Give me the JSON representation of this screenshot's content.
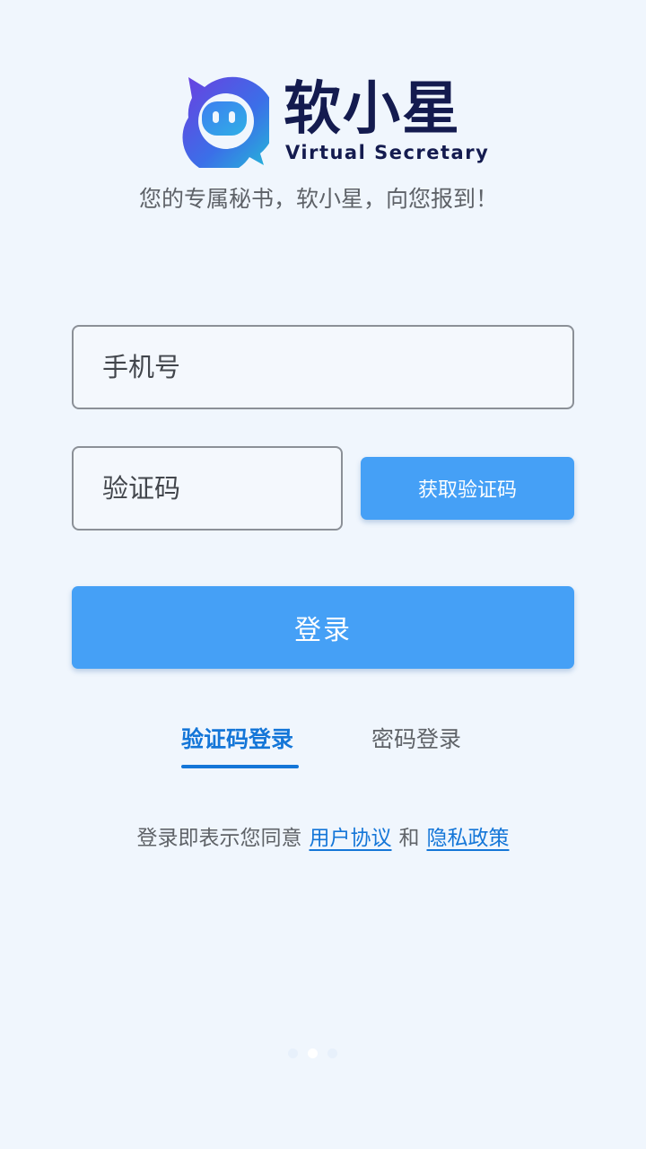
{
  "brand": {
    "name": "软小星",
    "subtitle": "Virtual Secretary",
    "tagline": "您的专属秘书，软小星，向您报到！"
  },
  "form": {
    "phone_placeholder": "手机号",
    "code_placeholder": "验证码",
    "get_code_label": "获取验证码",
    "login_label": "登录"
  },
  "tabs": [
    {
      "label": "验证码登录",
      "active": true
    },
    {
      "label": "密码登录",
      "active": false
    }
  ],
  "agreement": {
    "prefix": "登录即表示您同意",
    "user_agreement": "用户协议",
    "conjunction": "和",
    "privacy_policy": "隐私政策"
  },
  "pager": {
    "count": 3,
    "active_index": 1
  },
  "colors": {
    "background": "#f0f6fd",
    "accent": "#45a0f6",
    "link": "#1476d8",
    "brand_text": "#141b4f"
  }
}
